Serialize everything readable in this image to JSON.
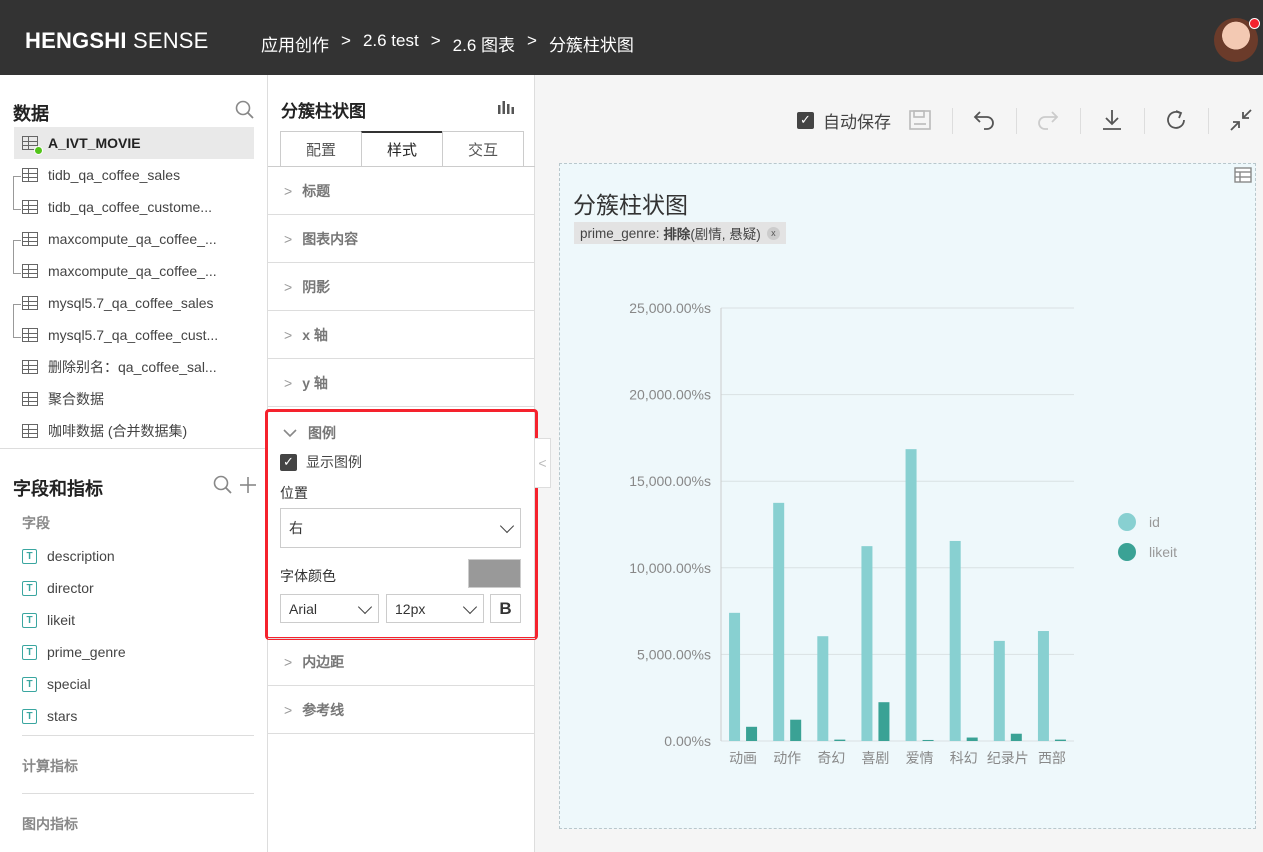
{
  "header": {
    "logo_bold": "HENGSHI",
    "logo_rest": "SENSE",
    "breadcrumbs": [
      "应用创作",
      "2.6 test",
      "2.6 图表",
      "分簇柱状图"
    ],
    "breadcrumb_sep": ">"
  },
  "data_panel": {
    "title": "数据",
    "datasets": [
      {
        "label": "A_IVT_MOVIE",
        "active": true
      },
      {
        "label": "tidb_qa_coffee_sales"
      },
      {
        "label": "tidb_qa_coffee_custome..."
      },
      {
        "label": "maxcompute_qa_coffee_..."
      },
      {
        "label": "maxcompute_qa_coffee_..."
      },
      {
        "label": "mysql5.7_qa_coffee_sales"
      },
      {
        "label": "mysql5.7_qa_coffee_cust..."
      },
      {
        "label": "删除别名：qa_coffee_sal..."
      },
      {
        "label": "聚合数据"
      },
      {
        "label": "咖啡数据 (合并数据集)"
      }
    ]
  },
  "fields_panel": {
    "title": "字段和指标",
    "fields_header": "字段",
    "fields": [
      "description",
      "director",
      "likeit",
      "prime_genre",
      "special",
      "stars"
    ],
    "calc_header": "计算指标",
    "inner_header": "图内指标"
  },
  "settings": {
    "title": "分簇柱状图",
    "tabs": [
      "配置",
      "样式",
      "交互"
    ],
    "active_tab": "样式",
    "sections_top": [
      "标题",
      "图表内容",
      "阴影",
      "x 轴",
      "y 轴"
    ],
    "legend": {
      "header": "图例",
      "show_label": "显示图例",
      "show_checked": true,
      "position_label": "位置",
      "position_value": "右",
      "font_color_label": "字体颜色",
      "font_color": "#999999",
      "font_family": "Arial",
      "font_size": "12px",
      "bold_label": "B"
    },
    "sections_bottom": [
      "内边距",
      "参考线"
    ]
  },
  "toolbar": {
    "autosave_label": "自动保存",
    "autosave_checked": true,
    "icons": [
      "save-icon",
      "undo-icon",
      "redo-icon",
      "download-icon",
      "refresh-icon",
      "collapse-icon"
    ]
  },
  "chart_card": {
    "title": "分簇柱状图",
    "filter_field": "prime_genre:",
    "filter_op": "排除",
    "filter_values": "(剧情, 悬疑)"
  },
  "chart_data": {
    "type": "bar",
    "categories": [
      "动画",
      "动作",
      "奇幻",
      "喜剧",
      "爱情",
      "科幻",
      "纪录片",
      "西部"
    ],
    "series": [
      {
        "name": "id",
        "color": "#88d0d1",
        "values": [
          7400,
          13750,
          6050,
          11250,
          16850,
          11550,
          5780,
          6350
        ]
      },
      {
        "name": "likeit",
        "color": "#3aa295",
        "values": [
          820,
          1230,
          80,
          2240,
          60,
          200,
          420,
          80
        ]
      }
    ],
    "ylim": [
      0,
      25000
    ],
    "yticks": [
      0,
      5000,
      10000,
      15000,
      20000,
      25000
    ],
    "ytick_labels": [
      "0.00%s",
      "5,000.00%s",
      "10,000.00%s",
      "15,000.00%s",
      "20,000.00%s",
      "25,000.00%s"
    ],
    "grid": true,
    "legend_position": "right"
  }
}
